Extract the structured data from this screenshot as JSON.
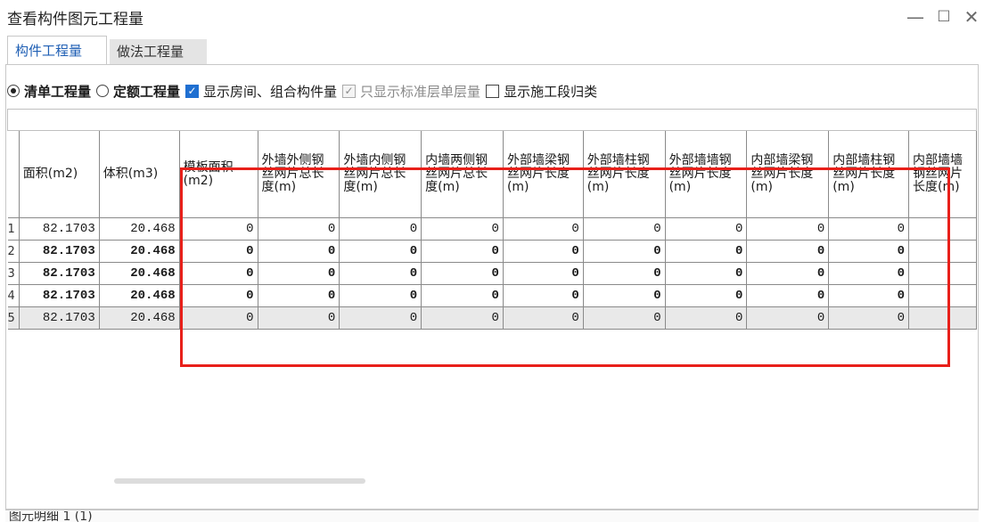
{
  "window": {
    "title": "查看构件图元工程量",
    "min": "—",
    "max": "☐",
    "close": "✕"
  },
  "tabs": [
    {
      "label": "构件工程量",
      "active": true
    },
    {
      "label": "做法工程量",
      "active": false
    }
  ],
  "options": {
    "radio1": "清单工程量",
    "radio2": "定额工程量",
    "check1": "显示房间、组合构件量",
    "check2": "只显示标准层单层量",
    "check3": "显示施工段归类",
    "checkmark": "✓"
  },
  "table": {
    "headers": [
      "面积(m2)",
      "体积(m3)",
      "模板面积(m2)",
      "外墙外侧钢丝网片总长度(m)",
      "外墙内侧钢丝网片总长度(m)",
      "内墙两侧钢丝网片总长度(m)",
      "外部墙梁钢丝网片长度(m)",
      "外部墙柱钢丝网片长度(m)",
      "外部墙墙钢丝网片长度(m)",
      "内部墙梁钢丝网片长度(m)",
      "内部墙柱钢丝网片长度(m)",
      "内部墙墙钢丝网片长度(m)"
    ],
    "rows": [
      {
        "index": "1",
        "values": [
          "82.1703",
          "20.468",
          "0",
          "0",
          "0",
          "0",
          "0",
          "0",
          "0",
          "0",
          "0",
          ""
        ]
      },
      {
        "index": "2",
        "values": [
          "82.1703",
          "20.468",
          "0",
          "0",
          "0",
          "0",
          "0",
          "0",
          "0",
          "0",
          "0",
          ""
        ]
      },
      {
        "index": "3",
        "values": [
          "82.1703",
          "20.468",
          "0",
          "0",
          "0",
          "0",
          "0",
          "0",
          "0",
          "0",
          "0",
          ""
        ]
      },
      {
        "index": "4",
        "values": [
          "82.1703",
          "20.468",
          "0",
          "0",
          "0",
          "0",
          "0",
          "0",
          "0",
          "0",
          "0",
          ""
        ]
      },
      {
        "index": "5",
        "values": [
          "82.1703",
          "20.468",
          "0",
          "0",
          "0",
          "0",
          "0",
          "0",
          "0",
          "0",
          "0",
          ""
        ]
      }
    ]
  },
  "footer": {
    "label": "图元明细  1 (1)"
  },
  "colors": {
    "highlight": "#e8201a",
    "accent": "#1f6fd1"
  }
}
